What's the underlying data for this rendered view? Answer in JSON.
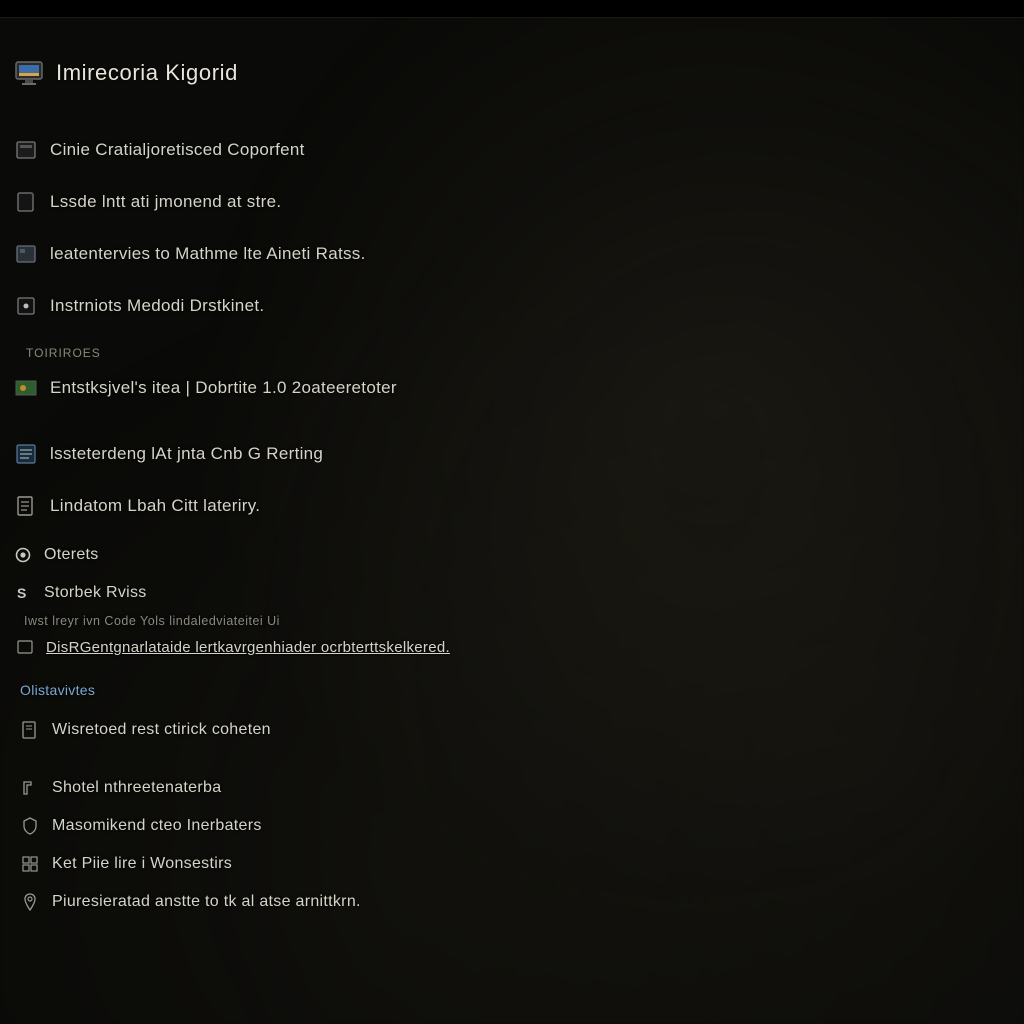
{
  "header": {
    "title": "Imirecoria Kigorid"
  },
  "primary": [
    {
      "label": "Cinie Cratialjoretisced Coporfent"
    },
    {
      "label": "Lssde lntt ati jmonend at stre."
    },
    {
      "label": "leatentervies to Mathme lte Aineti Ratss."
    },
    {
      "label": "Instrniots Medodi Drstkinet."
    }
  ],
  "section1_title": "TOIRIROES",
  "section1": [
    {
      "label": "Entstksjvel's itea | Dobrtite 1.0 2oateeretoter"
    },
    {
      "label": "lssteterdeng lAt jnta Cnb G Rerting"
    },
    {
      "label": "Lindatom Lbah Citt lateriry."
    }
  ],
  "options_label": "Oterets",
  "storek_label": "Storbek Rviss",
  "line_small": "Iwst  lreyr ivn Code Yols lindaledviateitei Ui",
  "line_link": "DisRGentgnarlataide lertkavrgenhiader ocrbterttskelkered.",
  "subheader": "Olistavivtes",
  "final": [
    {
      "label": "Wisretoed rest ctirick coheten"
    },
    {
      "label": "Shotel nthreetenaterba"
    },
    {
      "label": "Masomikend cteo Inerbaters"
    },
    {
      "label": "Ket Piie lire i Wonsestirs"
    },
    {
      "label": "Piuresieratad anstte to tk al atse arnittkrn."
    }
  ]
}
